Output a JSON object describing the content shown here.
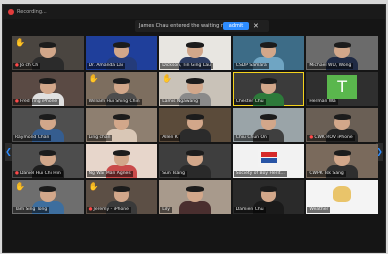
{
  "window": {
    "recording_label": "Recording..."
  },
  "waiting_room": {
    "message": "James Chau entered the waiting room",
    "admit_label": "admit",
    "close_glyph": "✕"
  },
  "navigation": {
    "prev_glyph": "❮",
    "next_glyph": "❯"
  },
  "participants": [
    {
      "name": "Jo ch Ch",
      "bg": "#4a4540",
      "shirt": "#2b2b2b",
      "muted": true,
      "hand": true
    },
    {
      "name": "Dr. Amanda Lai",
      "bg": "#1f3f9b",
      "shirt": "#243b7a",
      "muted": false
    },
    {
      "name": "Dickson, Tin Ging Lau",
      "bg": "#e8e6e1",
      "shirt": "#2f3e63",
      "muted": false
    },
    {
      "name": "CSDP Samara",
      "bg": "#3d6c87",
      "shirt": "#6fa5c3",
      "muted": false
    },
    {
      "name": "Michael WU, Wong",
      "bg": "#6b6b6b",
      "shirt": "#1f2a44",
      "muted": false
    },
    {
      "name": "Fred Ting iPhone",
      "bg": "#5a4a44",
      "shirt": "#e0e0e0",
      "muted": true
    },
    {
      "name": "William Hui Shing Chin",
      "bg": "#7d6e5f",
      "shirt": "#4d4d4d",
      "muted": false,
      "hand": true
    },
    {
      "name": "Lamis Ngawang",
      "bg": "#c9c2b8",
      "shirt": "#8a8a8a",
      "muted": false,
      "hand": true
    },
    {
      "name": "Chester Chu",
      "bg": "#3b3b3b",
      "shirt": "#2d7a3a",
      "muted": false,
      "active": true
    },
    {
      "name": "Herman Wa",
      "bg": "#2f2f2f",
      "avatar": "T",
      "muted": false
    },
    {
      "name": "Raymond Chan",
      "bg": "#4f4f4f",
      "shirt": "#355d8f",
      "muted": false
    },
    {
      "name": "Ling chan",
      "bg": "#8e7f70",
      "shirt": "#d9c7b6",
      "muted": false
    },
    {
      "name": "Allen K",
      "bg": "#5b4b3a",
      "shirt": "#2b2b2b",
      "muted": false
    },
    {
      "name": "Chiu Chun On",
      "bg": "#9aa4a8",
      "shirt": "#3f3f3f",
      "muted": false
    },
    {
      "name": "CWK ROV iPhone",
      "bg": "#6a5f55",
      "shirt": "#272727",
      "muted": true
    },
    {
      "name": "Daniel Hui Chi Hin",
      "bg": "#4d4d4d",
      "shirt": "#1e1e1e",
      "muted": true
    },
    {
      "name": "Ng Wai Man Agnes",
      "bg": "#e7d6cb",
      "shirt": "#c94a4a",
      "muted": false
    },
    {
      "name": "Sun Tsang",
      "bg": "#3e3e3e",
      "shirt": "#2a2a2a",
      "muted": false
    },
    {
      "name": "Society of Boy Herit...",
      "bg": "#f2f2f2",
      "logo": true,
      "muted": false
    },
    {
      "name": "CWPK Tsk Sang",
      "bg": "#7a6a5c",
      "shirt": "#2e2e2e",
      "muted": false
    },
    {
      "name": "Tam Sing Tong",
      "bg": "#6e6e6e",
      "shirt": "#3d6e9e",
      "muted": false,
      "hand": true
    },
    {
      "name": "Jeremy - iPhone",
      "bg": "#5c4f45",
      "shirt": "#3a3a3a",
      "muted": true,
      "hand": true
    },
    {
      "name": "Lily",
      "bg": "#a89a8c",
      "shirt": "#4a2f2f",
      "muted": false
    },
    {
      "name": "Damien Chu",
      "bg": "#2a2a2a",
      "shirt": "#1a1a1a",
      "muted": false
    },
    {
      "name": "Weather",
      "bg": "#f4f4f4",
      "turtle": true,
      "muted": false
    }
  ]
}
